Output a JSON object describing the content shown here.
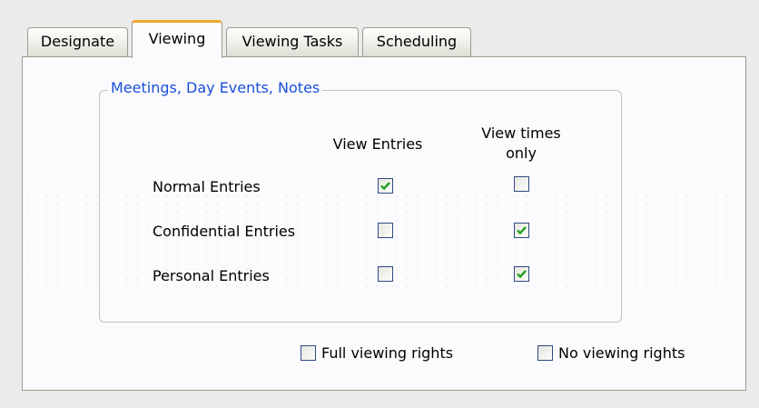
{
  "tabs": [
    {
      "label": "Designate",
      "active": false
    },
    {
      "label": "Viewing",
      "active": true
    },
    {
      "label": "Viewing Tasks",
      "active": false
    },
    {
      "label": "Scheduling",
      "active": false
    }
  ],
  "group": {
    "title": "Meetings, Day Events, Notes",
    "columns": {
      "view_entries": "View Entries",
      "view_times_line1": "View times",
      "view_times_line2": "only"
    },
    "rows": [
      {
        "label": "Normal Entries",
        "view_entries": true,
        "view_times_only": false
      },
      {
        "label": "Confidential Entries",
        "view_entries": false,
        "view_times_only": true
      },
      {
        "label": "Personal Entries",
        "view_entries": false,
        "view_times_only": true
      }
    ]
  },
  "options": {
    "full_viewing_rights": {
      "label": "Full viewing rights",
      "checked": false
    },
    "no_viewing_rights": {
      "label": "No viewing rights",
      "checked": false
    }
  },
  "colors": {
    "active_tab_accent": "#f0a630",
    "group_title": "#1a4fd8",
    "check_mark": "#21a121",
    "checkbox_border": "#2e4b81"
  },
  "icons": {
    "check": "checkmark-icon"
  }
}
